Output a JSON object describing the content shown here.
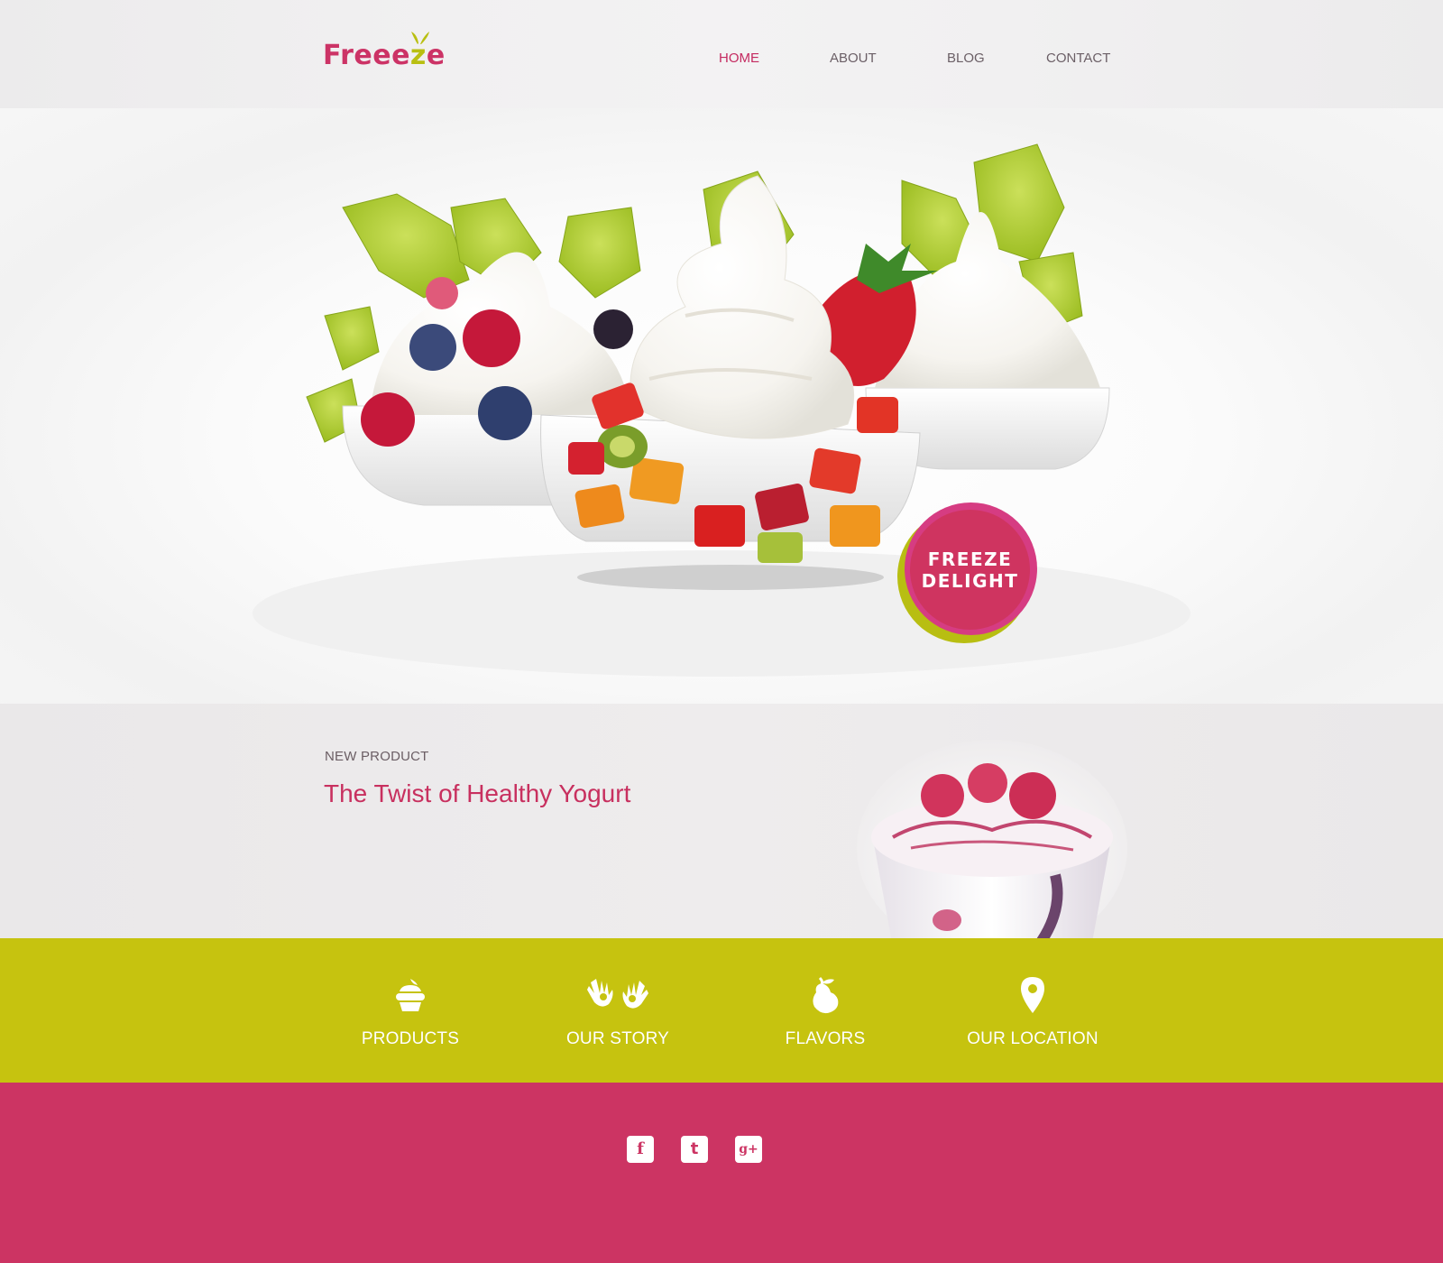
{
  "brand": {
    "name_part1": "Freee",
    "name_part2": "z",
    "name_part3": "e",
    "primary_color": "#cc3463",
    "accent_color": "#c6c30f"
  },
  "nav": {
    "items": [
      {
        "label": "HOME",
        "active": true
      },
      {
        "label": "ABOUT",
        "active": false
      },
      {
        "label": "BLOG",
        "active": false
      },
      {
        "label": "CONTACT",
        "active": false
      }
    ]
  },
  "hero": {
    "badge_line1": "FREEZE",
    "badge_line2": "DELIGHT"
  },
  "product": {
    "eyebrow": "NEW PRODUCT",
    "title": "The Twist of Healthy Yogurt"
  },
  "features": [
    {
      "label": "PRODUCTS",
      "icon": "cupcake-icon"
    },
    {
      "label": "OUR STORY",
      "icon": "hands-icon"
    },
    {
      "label": "FLAVORS",
      "icon": "pear-icon"
    },
    {
      "label": "OUR LOCATION",
      "icon": "location-pin-icon"
    }
  ],
  "social": [
    {
      "glyph": "f",
      "icon": "facebook-icon"
    },
    {
      "glyph": "t",
      "icon": "twitter-icon"
    },
    {
      "glyph": "g+",
      "icon": "google-plus-icon"
    }
  ]
}
